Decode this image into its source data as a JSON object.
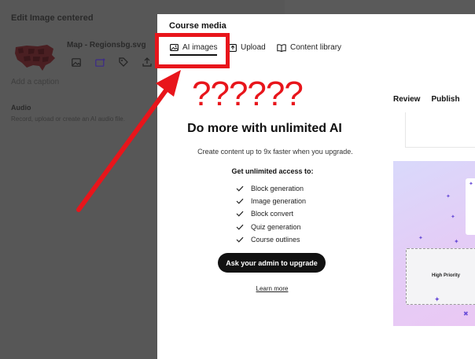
{
  "background_editor": {
    "title": "Edit Image centered",
    "file_name": "Map - Regionsbg.svg",
    "caption_placeholder": "Add a caption",
    "audio": {
      "heading": "Audio",
      "description": "Record, upload or create an AI audio file."
    },
    "tool_icons": [
      "image-icon",
      "ai-image-icon",
      "tag-icon",
      "upload-icon"
    ]
  },
  "modal": {
    "title": "Course media",
    "tabs": [
      {
        "label": "AI images",
        "icon": "ai-image-icon",
        "active": true
      },
      {
        "label": "Upload",
        "icon": "upload-icon",
        "active": false
      },
      {
        "label": "Content library",
        "icon": "book-icon",
        "active": false
      }
    ],
    "toolbar": {
      "review": "Review",
      "publish": "Publish"
    },
    "upsell": {
      "heading": "Do more with unlimited AI",
      "subtext": "Create content up to 9x faster when you upgrade.",
      "access_heading": "Get unlimited access to:",
      "features": [
        "Block generation",
        "Image generation",
        "Block convert",
        "Quiz generation",
        "Course outlines"
      ],
      "button_label": "Ask your admin to upgrade",
      "link_label": "Learn more"
    },
    "promo": {
      "card_label": "High Priority"
    }
  },
  "annotation": {
    "text": "??????",
    "color": "#e8151b"
  },
  "colors": {
    "accent": "#111111",
    "promo_purple": "#6b4fd8",
    "overlay": "#575757"
  }
}
